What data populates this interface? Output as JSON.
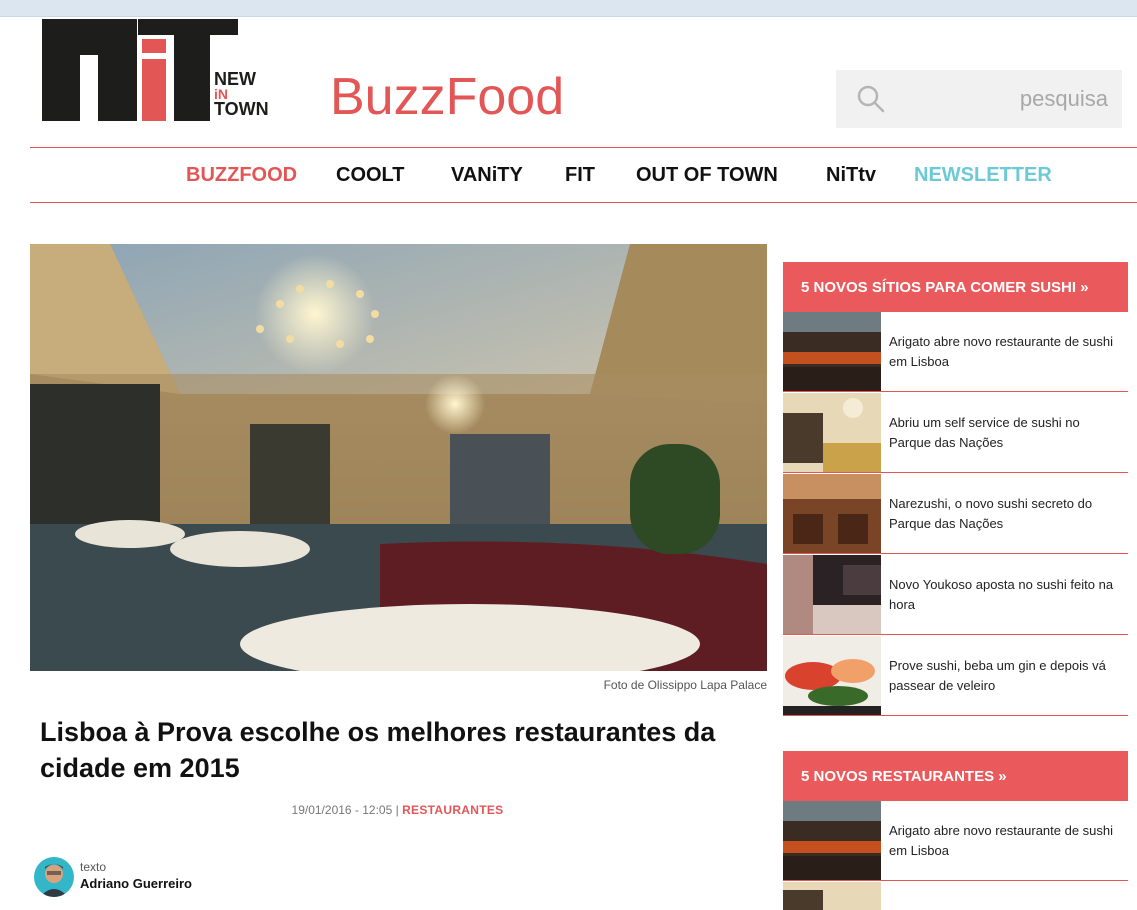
{
  "logo": {
    "line1": "NEW",
    "line2": "iN",
    "line3": "TOWN"
  },
  "brand": "BuzzFood",
  "search": {
    "placeholder": "pesquisa",
    "icon": "search-icon"
  },
  "nav": {
    "items": [
      {
        "label": "BUZZFOOD"
      },
      {
        "label": "COOLT"
      },
      {
        "label": "VANiTY"
      },
      {
        "label": "FIT"
      },
      {
        "label": "OUT OF TOWN"
      },
      {
        "label": "NiTtv"
      },
      {
        "label": "NEWSLETTER"
      }
    ]
  },
  "article": {
    "photo_caption": "Foto de Olissippo Lapa Palace",
    "title": "Lisboa à Prova escolhe os melhores restaurantes da cidade em 2015",
    "date": "19/01/2016 - 12:05 |",
    "category": "RESTAURANTES",
    "author_label": "texto",
    "author_name": "Adriano Guerreiro"
  },
  "sidebar": {
    "sections": [
      {
        "heading": "5 NOVOS SÍTIOS PARA COMER SUSHI »",
        "items": [
          {
            "title": "Arigato abre novo restaurante de sushi em Lisboa"
          },
          {
            "title": "Abriu um self service de sushi no Parque das Nações"
          },
          {
            "title": "Narezushi, o novo sushi secreto do Parque das Nações"
          },
          {
            "title": "Novo Youkoso aposta no sushi feito na hora"
          },
          {
            "title": "Prove sushi, beba um gin e depois vá passear de veleiro"
          }
        ]
      },
      {
        "heading": "5 NOVOS RESTAURANTES »",
        "items": [
          {
            "title": "Arigato abre novo restaurante de sushi em Lisboa"
          }
        ]
      }
    ]
  },
  "colors": {
    "accent": "#e35656",
    "newsletter": "#6ccad7",
    "sidebar_header": "#ea5a5c"
  }
}
